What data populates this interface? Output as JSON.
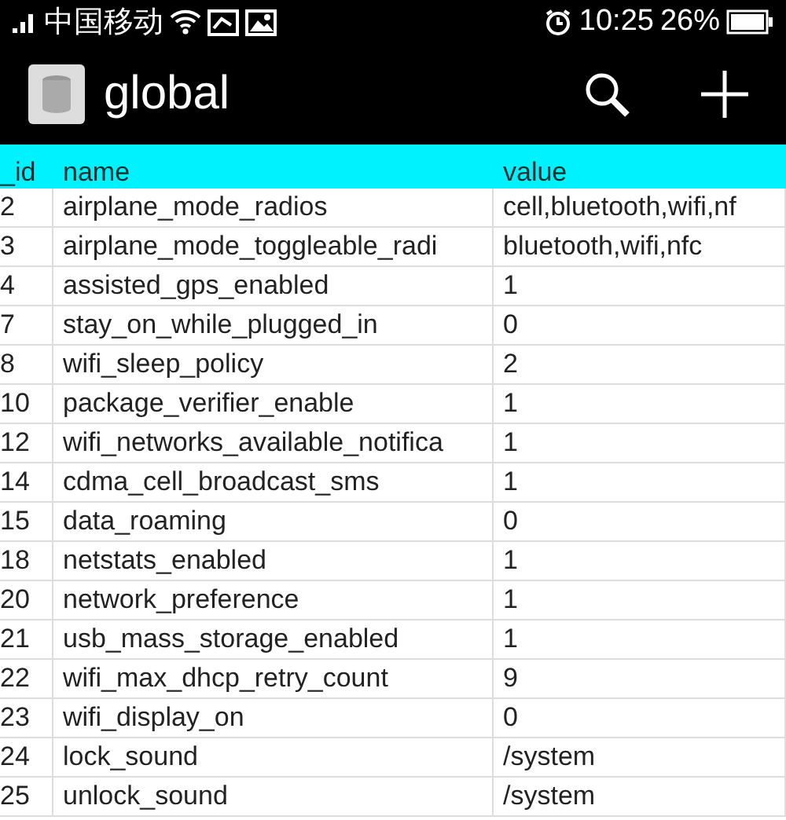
{
  "status_bar": {
    "carrier": "中国移动",
    "time": "10:25",
    "battery": "26%"
  },
  "toolbar": {
    "title": "global"
  },
  "table": {
    "columns": [
      "_id",
      "name",
      "value"
    ],
    "rows": [
      [
        "2",
        "airplane_mode_radios",
        "cell,bluetooth,wifi,nf"
      ],
      [
        "3",
        "airplane_mode_toggleable_radi",
        "bluetooth,wifi,nfc"
      ],
      [
        "4",
        "assisted_gps_enabled",
        "1"
      ],
      [
        "7",
        "stay_on_while_plugged_in",
        "0"
      ],
      [
        "8",
        "wifi_sleep_policy",
        "2"
      ],
      [
        "10",
        "package_verifier_enable",
        "1"
      ],
      [
        "12",
        "wifi_networks_available_notifica",
        "1"
      ],
      [
        "14",
        "cdma_cell_broadcast_sms",
        "1"
      ],
      [
        "15",
        "data_roaming",
        "0"
      ],
      [
        "18",
        "netstats_enabled",
        "1"
      ],
      [
        "20",
        "network_preference",
        "1"
      ],
      [
        "21",
        "usb_mass_storage_enabled",
        "1"
      ],
      [
        "22",
        "wifi_max_dhcp_retry_count",
        "9"
      ],
      [
        "23",
        "wifi_display_on",
        "0"
      ],
      [
        "24",
        "lock_sound",
        "/system"
      ],
      [
        "25",
        "unlock_sound",
        "/system"
      ]
    ]
  }
}
